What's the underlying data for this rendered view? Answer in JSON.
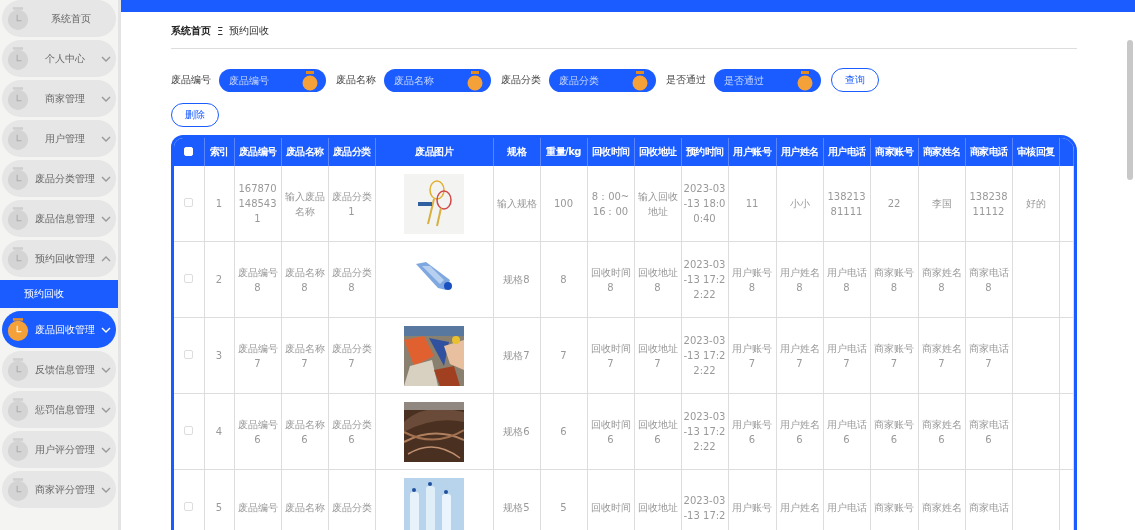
{
  "sidebar": {
    "items": [
      {
        "label": "系统首页",
        "kind": "link",
        "selected": false
      },
      {
        "label": "个人中心",
        "kind": "menu",
        "expanded": false,
        "selected": false
      },
      {
        "label": "商家管理",
        "kind": "menu",
        "expanded": false,
        "selected": false
      },
      {
        "label": "用户管理",
        "kind": "menu",
        "expanded": false,
        "selected": false
      },
      {
        "label": "废品分类管理",
        "kind": "menu",
        "expanded": false,
        "selected": false
      },
      {
        "label": "废品信息管理",
        "kind": "menu",
        "expanded": false,
        "selected": false
      },
      {
        "label": "预约回收管理",
        "kind": "menu",
        "expanded": true,
        "selected": false,
        "children": [
          {
            "label": "预约回收",
            "selected": true
          }
        ]
      },
      {
        "label": "废品回收管理",
        "kind": "menu",
        "expanded": false,
        "selected": true
      },
      {
        "label": "反馈信息管理",
        "kind": "menu",
        "expanded": false,
        "selected": false
      },
      {
        "label": "惩罚信息管理",
        "kind": "menu",
        "expanded": false,
        "selected": false
      },
      {
        "label": "用户评分管理",
        "kind": "menu",
        "expanded": false,
        "selected": false
      },
      {
        "label": "商家评分管理",
        "kind": "menu",
        "expanded": false,
        "selected": false
      }
    ]
  },
  "breadcrumb": {
    "items": [
      "系统首页",
      "预约回收"
    ],
    "separator": "Ξ"
  },
  "filters": [
    {
      "label": "废品编号",
      "placeholder": "废品编号"
    },
    {
      "label": "废品名称",
      "placeholder": "废品名称"
    },
    {
      "label": "废品分类",
      "placeholder": "废品分类"
    },
    {
      "label": "是否通过",
      "placeholder": "是否通过"
    }
  ],
  "search_button": "查询",
  "delete_button": "删除",
  "table": {
    "select_all_checked": false,
    "columns": [
      "索引",
      "废品编号",
      "废品名称",
      "废品分类",
      "废品图片",
      "规格",
      "重量/kg",
      "回收时间",
      "回收地址",
      "预约时间",
      "用户账号",
      "用户姓名",
      "用户电话",
      "商家账号",
      "商家姓名",
      "商家电话",
      "审核回复"
    ],
    "rows": [
      {
        "checked": false,
        "cells": [
          "1",
          "1678701485431",
          "输入废品名称",
          "废品分类1",
          {
            "kind": "picture"
          },
          "输入规格",
          "100",
          "8：00~16：00",
          "输入回收地址",
          "2023-03-13 18:00:40",
          "11",
          "小小",
          "13821381111",
          "22",
          "李国",
          "13823811112",
          "好的"
        ]
      },
      {
        "checked": false,
        "cells": [
          "2",
          "废品编号8",
          "废品名称8",
          "废品分类8",
          {
            "kind": "picture"
          },
          "规格8",
          "8",
          "回收时间8",
          "回收地址8",
          "2023-03-13 17:22:22",
          "用户账号8",
          "用户姓名8",
          "用户电话8",
          "商家账号8",
          "商家姓名8",
          "商家电话8",
          ""
        ]
      },
      {
        "checked": false,
        "cells": [
          "3",
          "废品编号7",
          "废品名称7",
          "废品分类7",
          {
            "kind": "picture"
          },
          "规格7",
          "7",
          "回收时间7",
          "回收地址7",
          "2023-03-13 17:22:22",
          "用户账号7",
          "用户姓名7",
          "用户电话7",
          "商家账号7",
          "商家姓名7",
          "商家电话7",
          ""
        ]
      },
      {
        "checked": false,
        "cells": [
          "4",
          "废品编号6",
          "废品名称6",
          "废品分类6",
          {
            "kind": "picture"
          },
          "规格6",
          "6",
          "回收时间6",
          "回收地址6",
          "2023-03-13 17:22:22",
          "用户账号6",
          "用户姓名6",
          "用户电话6",
          "商家账号6",
          "商家姓名6",
          "商家电话6",
          ""
        ]
      },
      {
        "checked": false,
        "cells": [
          "5",
          "废品编号",
          "废品名称",
          "废品分类",
          {
            "kind": "picture"
          },
          "规格5",
          "5",
          "回收时间",
          "回收地址",
          "2023-03-13 17:2",
          "用户账号",
          "用户姓名",
          "用户电话",
          "商家账号",
          "商家姓名",
          "商家电话",
          ""
        ]
      }
    ]
  }
}
